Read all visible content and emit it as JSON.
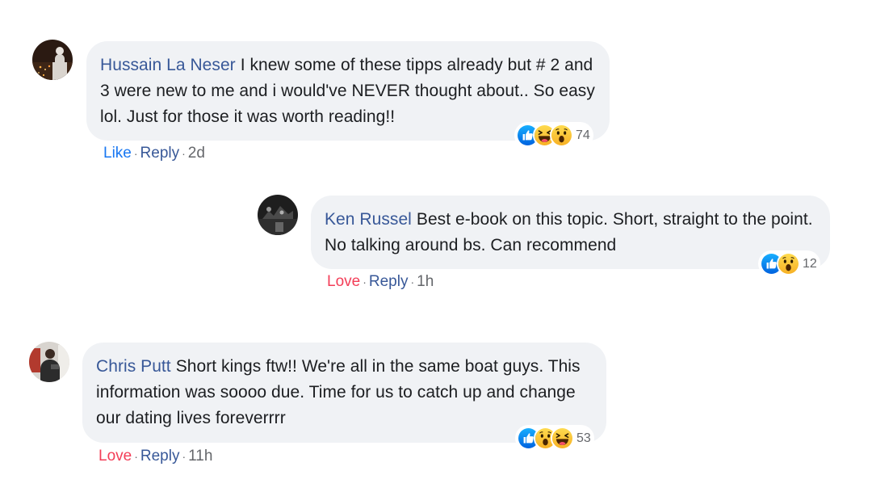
{
  "comments": [
    {
      "author": "Hussain La Neser",
      "text": "I knew some of these tipps already but # 2 and 3 were new to me and i would've NEVER thought about.. So easy lol. Just for those it was worth reading!!",
      "reaction_icons": [
        "like-icon",
        "haha-icon",
        "wow-icon"
      ],
      "reaction_count": "74",
      "action_first": "Like",
      "action_reply": "Reply",
      "time": "2d",
      "dot": "·"
    },
    {
      "author": "Ken Russel",
      "text": "Best e-book on this topic. Short, straight to the point. No talking around bs. Can recommend",
      "reaction_icons": [
        "like-icon",
        "wow-icon"
      ],
      "reaction_count": "12",
      "action_first": "Love",
      "action_reply": "Reply",
      "time": "1h",
      "dot": "·"
    },
    {
      "author": "Chris Putt",
      "text": "Short kings ftw!! We're all in the same boat guys. This information was soooo due. Time for us to catch up and change our dating lives foreverrrr",
      "reaction_icons": [
        "like-icon",
        "wow-icon",
        "haha-icon"
      ],
      "reaction_count": "53",
      "action_first": "Love",
      "action_reply": "Reply",
      "time": "11h",
      "dot": "·"
    }
  ],
  "colors": {
    "author": "#385898",
    "like": "#1877f2",
    "love": "#f33e58",
    "bubble": "#f0f2f5",
    "meta": "#65676b"
  }
}
